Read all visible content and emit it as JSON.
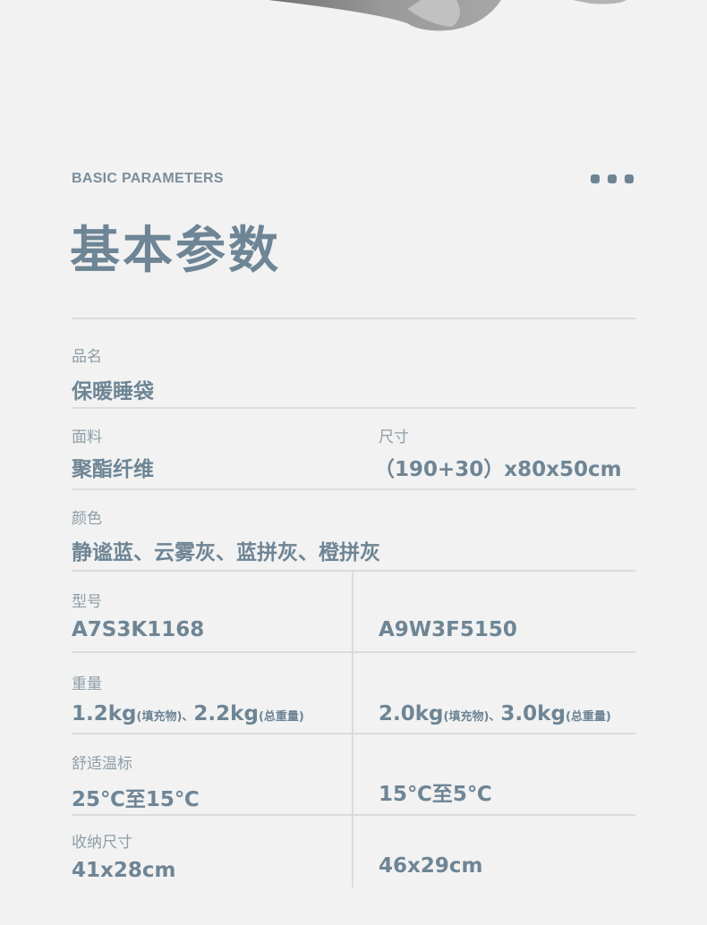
{
  "header": {
    "eyebrow": "BASIC PARAMETERS",
    "title": "基本参数"
  },
  "params": {
    "name_label": "品名",
    "name_value": "保暖睡袋",
    "fabric_label": "面料",
    "fabric_value": "聚酯纤维",
    "size_label": "尺寸",
    "size_value": "（190+30）x80x50cm",
    "color_label": "颜色",
    "color_value": "静谧蓝、云雾灰、蓝拼灰、橙拼灰",
    "model_label": "型号",
    "model_a": "A7S3K1168",
    "model_b": "A9W3F5150",
    "weight_label": "重量",
    "weight_a_fill": "1.2kg",
    "weight_a_fill_note": "(填充物)",
    "weight_a_sep": "、",
    "weight_a_total": "2.2kg",
    "weight_a_total_note": "(总重量)",
    "weight_b_fill": "2.0kg",
    "weight_b_fill_note": "(填充物)",
    "weight_b_sep": "、",
    "weight_b_total": "3.0kg",
    "weight_b_total_note": "(总重量)",
    "comfort_label": "舒适温标",
    "comfort_a": "25℃至15℃",
    "comfort_b": "15℃至5℃",
    "pack_label": "收纳尺寸",
    "pack_a": "41x28cm",
    "pack_b": "46x29cm"
  },
  "colors": {
    "background": "#f2f2f2",
    "accent": "#6e8595",
    "label": "#8e9da6",
    "divider": "#d9dcdf"
  }
}
